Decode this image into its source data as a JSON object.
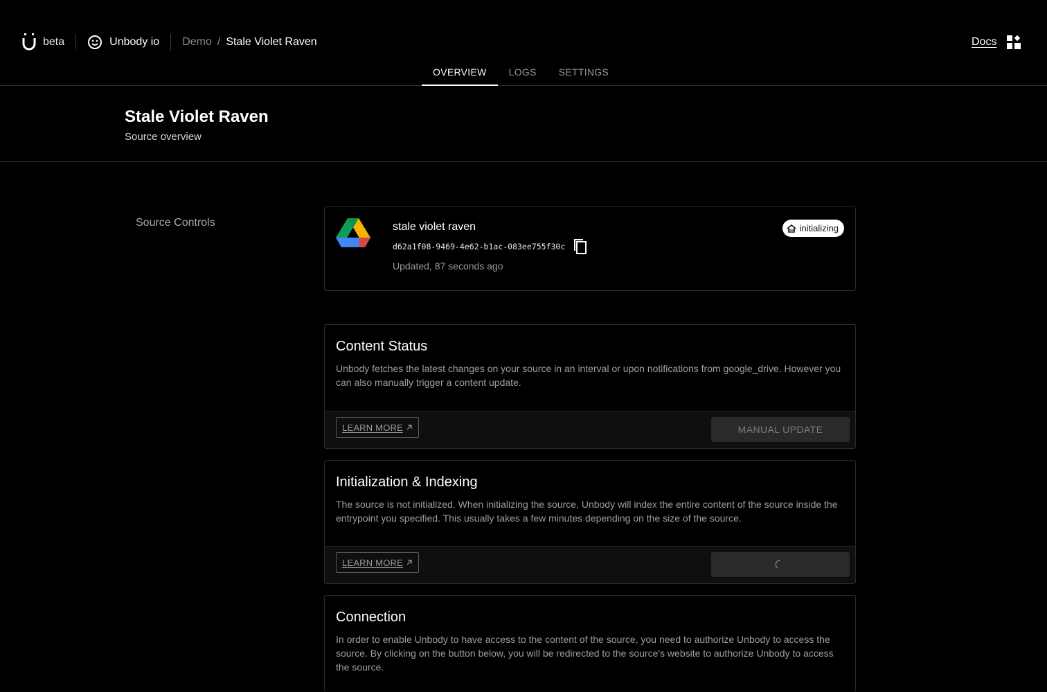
{
  "header": {
    "brand_label": "beta",
    "org_name": "Unbody io",
    "breadcrumb": {
      "parent": "Demo",
      "separator": "/",
      "current": "Stale Violet Raven"
    },
    "docs_label": "Docs"
  },
  "tabs": [
    {
      "label": "OVERVIEW",
      "active": true
    },
    {
      "label": "LOGS",
      "active": false
    },
    {
      "label": "SETTINGS",
      "active": false
    }
  ],
  "page": {
    "title": "Stale Violet Raven",
    "subtitle": "Source overview"
  },
  "sidebar": {
    "section_label": "Source Controls"
  },
  "source": {
    "name": "stale violet raven",
    "id": "d62a1f08-9469-4e62-b1ac-083ee755f30c",
    "updated": "Updated,  87 seconds ago",
    "status": "initializing",
    "provider_icon": "google-drive-icon"
  },
  "cards": {
    "content_status": {
      "title": "Content Status",
      "description": "Unbody fetches the latest changes on your source in an interval or upon notifications from google_drive. However you can also manually trigger a content update.",
      "learn_more": "LEARN MORE",
      "action_label": "MANUAL UPDATE"
    },
    "initialization": {
      "title": "Initialization & Indexing",
      "description": "The source is not initialized. When initializing the source, Unbody will index the entire content of the source inside the entrypoint you specified. This usually takes a few minutes depending on the size of the source.",
      "learn_more": "LEARN MORE"
    },
    "connection": {
      "title": "Connection",
      "description": "In order to enable Unbody to have access to the content of the source, you need to authorize Unbody to access the source. By clicking on the button below, you will be redirected to the source's website to authorize Unbody to access the source."
    }
  },
  "colors": {
    "background": "#000000",
    "border": "#2b2b2b",
    "muted_text": "#9e9e9e",
    "drive_green": "#0f9d58",
    "drive_yellow": "#f4b400",
    "drive_blue": "#4285f4",
    "drive_red": "#db4437"
  }
}
